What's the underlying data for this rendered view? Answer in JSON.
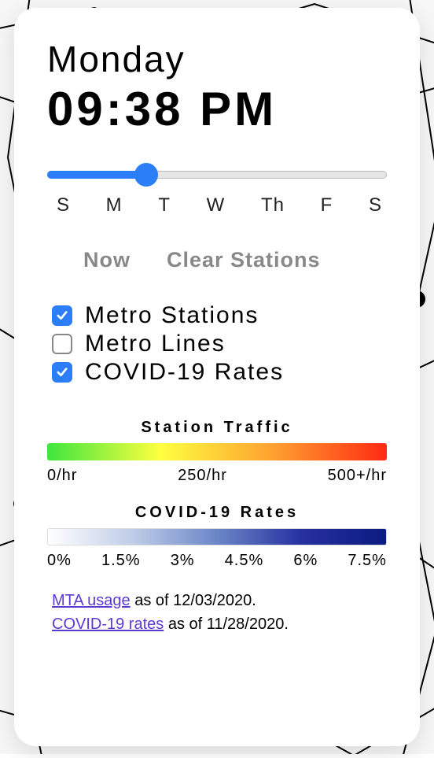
{
  "header": {
    "day": "Monday",
    "time": "09:38 PM"
  },
  "slider": {
    "position_pct": 29
  },
  "day_labels": [
    "S",
    "M",
    "T",
    "W",
    "Th",
    "F",
    "S"
  ],
  "actions": {
    "now": "Now",
    "clear": "Clear Stations"
  },
  "checks": [
    {
      "label": "Metro Stations",
      "checked": true
    },
    {
      "label": "Metro Lines",
      "checked": false
    },
    {
      "label": "COVID-19 Rates",
      "checked": true
    }
  ],
  "legend_traffic": {
    "title": "Station Traffic",
    "ticks": [
      "0/hr",
      "250/hr",
      "500+/hr"
    ]
  },
  "legend_covid": {
    "title": "COVID-19 Rates",
    "ticks": [
      "0%",
      "1.5%",
      "3%",
      "4.5%",
      "6%",
      "7.5%"
    ]
  },
  "footer": {
    "mta_link": "MTA usage",
    "mta_text": " as of 12/03/2020.",
    "covid_link": "COVID-19 rates",
    "covid_text": " as of 11/28/2020."
  }
}
